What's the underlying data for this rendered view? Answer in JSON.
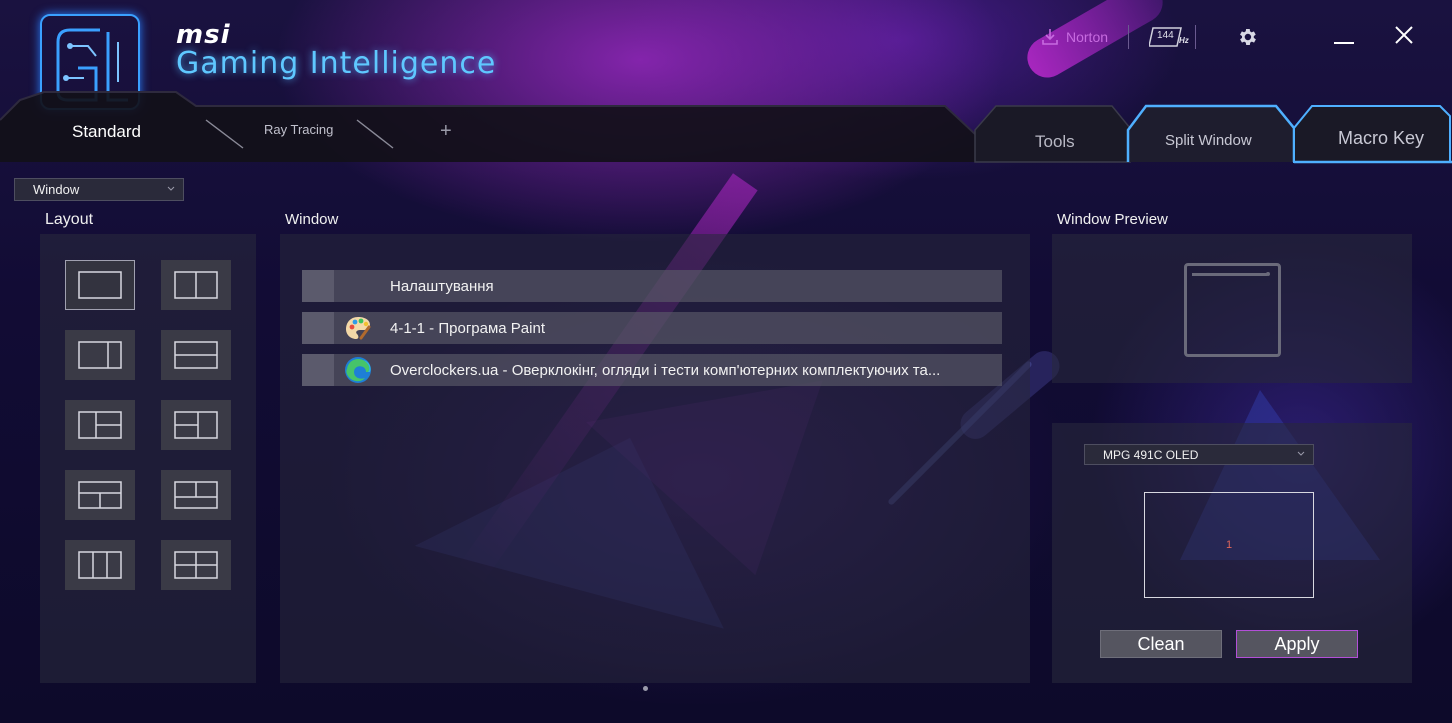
{
  "header": {
    "brand_logo": "msi",
    "brand_title": "Gaming Intelligence",
    "norton_label": "Norton",
    "refresh_badge": "144",
    "refresh_unit": "Hz"
  },
  "tabs": {
    "left": [
      {
        "label": "Standard"
      },
      {
        "label": "Ray Tracing"
      },
      {
        "label": "+"
      }
    ],
    "right": [
      {
        "label": "Tools"
      },
      {
        "label": "Split Window"
      },
      {
        "label": "Macro Key"
      }
    ]
  },
  "mode_select": {
    "value": "Window"
  },
  "sections": {
    "layout": "Layout",
    "window": "Window",
    "preview": "Window Preview"
  },
  "windows": [
    {
      "title": "Налаштування",
      "icon": "none"
    },
    {
      "title": "4-1-1 - Програма Paint",
      "icon": "paint-palette-icon"
    },
    {
      "title": "Overclockers.ua - Оверклокінг, огляди і тести комп'ютерних комплектуючих та...",
      "icon": "edge-browser-icon"
    }
  ],
  "monitor": {
    "select_value": "MPG 491C OLED",
    "zone_number": "1"
  },
  "actions": {
    "clean": "Clean",
    "apply": "Apply"
  },
  "colors": {
    "accent_cyan": "#5fc8ff",
    "accent_purple": "#b34fd8",
    "norton": "#c76be0"
  }
}
